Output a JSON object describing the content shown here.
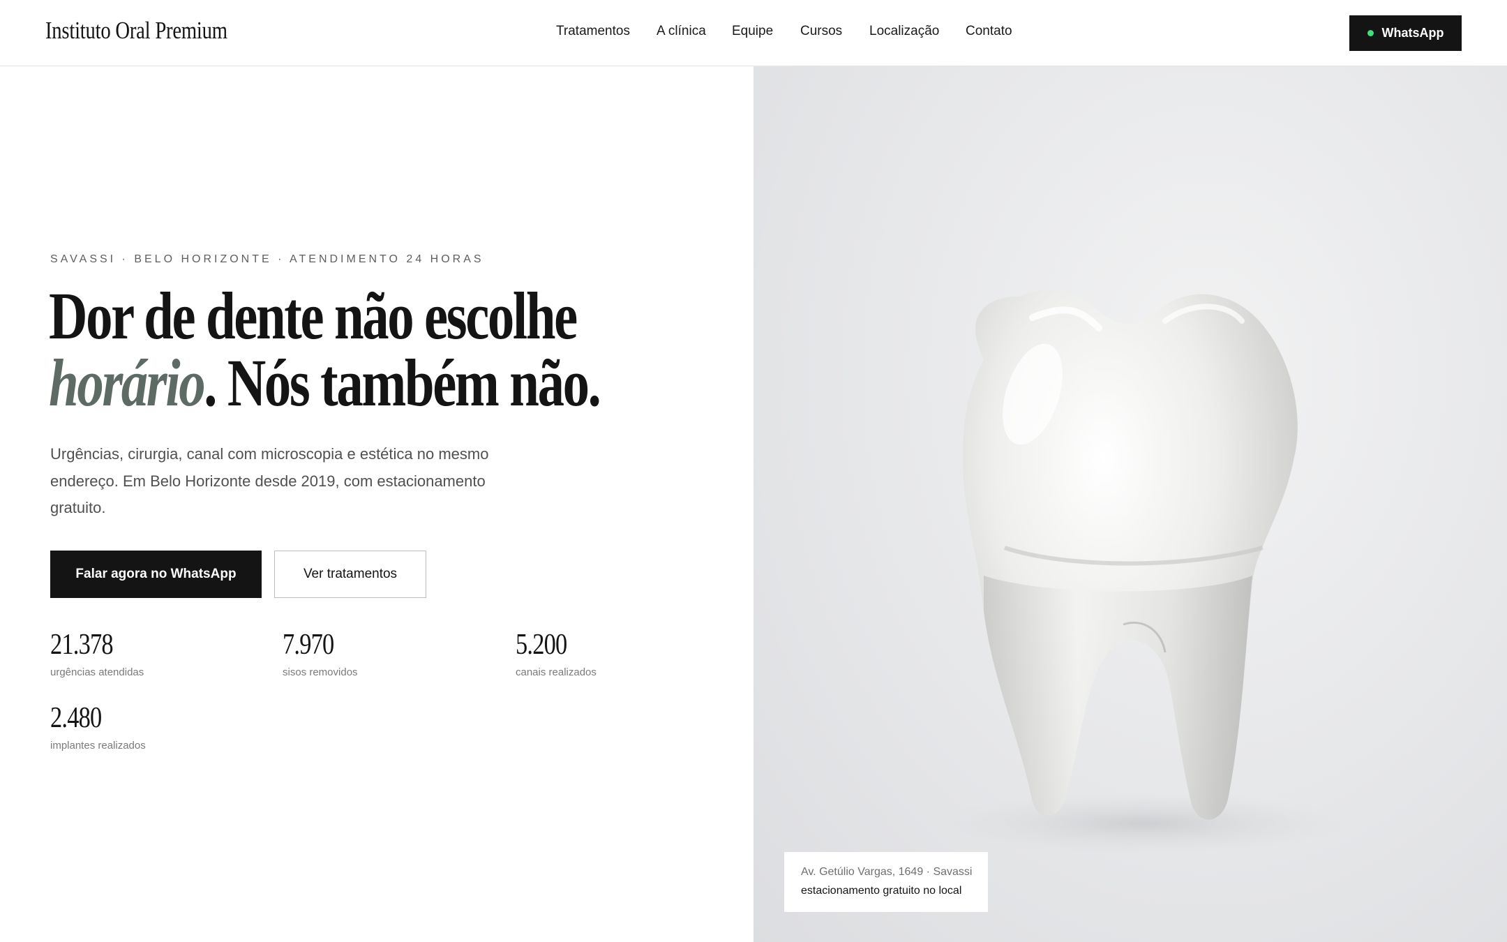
{
  "header": {
    "brand": "Instituto Oral Premium",
    "nav": [
      "Tratamentos",
      "A clínica",
      "Equipe",
      "Cursos",
      "Localização",
      "Contato"
    ],
    "whatsapp_label": "WhatsApp"
  },
  "hero": {
    "eyebrow": "SAVASSI · BELO HORIZONTE · ATENDIMENTO 24 HORAS",
    "headline_line1": "Dor de dente não escolhe",
    "headline_italic": "horário",
    "headline_line2_rest": ". Nós também não.",
    "lead": "Urgências, cirurgia, canal com microscopia e estética no mesmo endereço. Em Belo Horizonte desde 2019, com estacionamento gratuito.",
    "primary_cta": "Falar agora no WhatsApp",
    "secondary_cta": "Ver tratamentos",
    "stats": [
      {
        "value": "21.378",
        "label": "urgências atendidas"
      },
      {
        "value": "7.970",
        "label": "sisos removidos"
      },
      {
        "value": "5.200",
        "label": "canais realizados"
      },
      {
        "value": "2.480",
        "label": "implantes realizados"
      }
    ]
  },
  "address_card": {
    "line1": "Av. Getúlio Vargas, 1649 · Savassi",
    "line2": "estacionamento gratuito no local"
  },
  "colors": {
    "dark": "#141414",
    "italic_accent": "#5d6b64",
    "whatsapp_dot": "#3ee07a"
  }
}
